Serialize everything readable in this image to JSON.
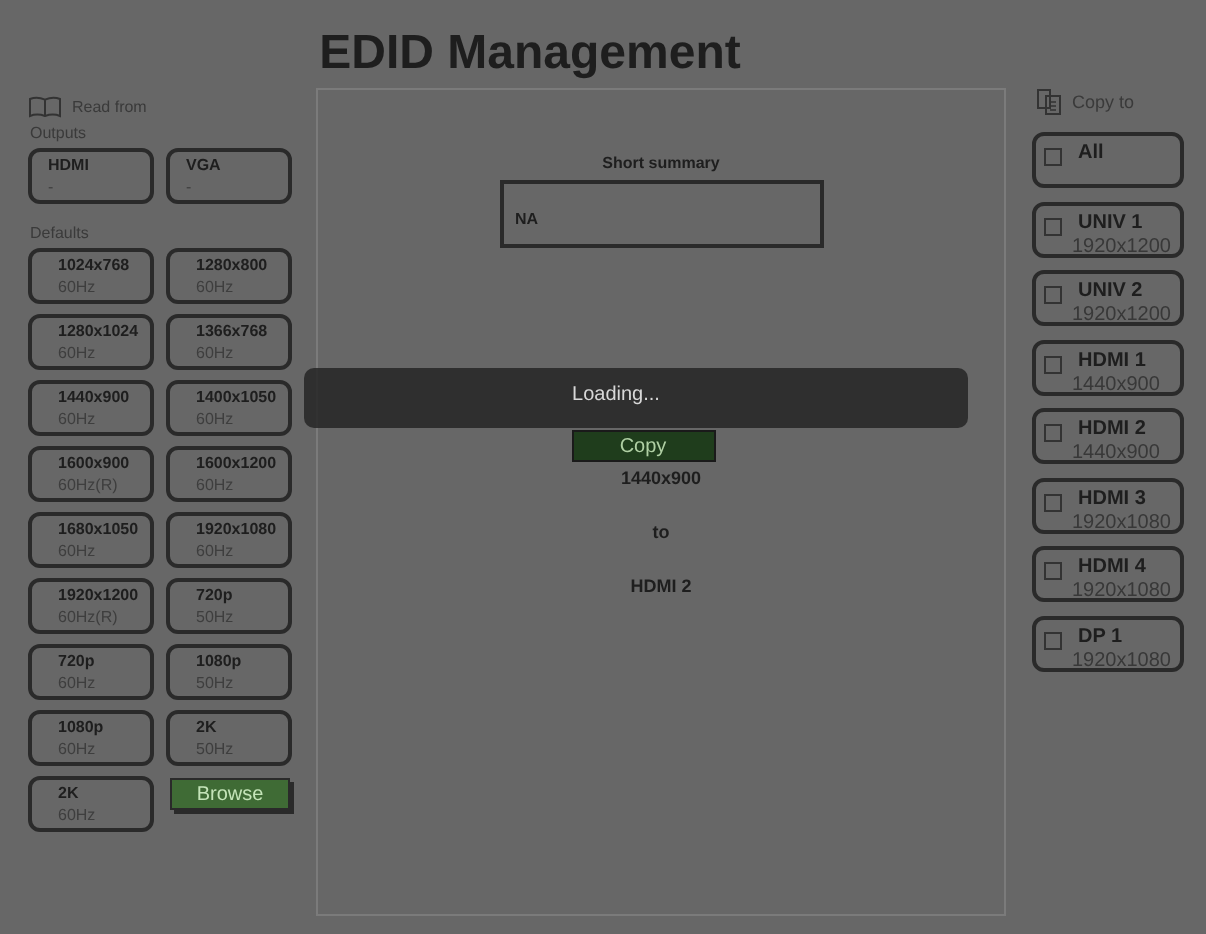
{
  "title": "EDID Management",
  "read_from": {
    "label": "Read from",
    "outputs_label": "Outputs",
    "outputs": [
      {
        "name": "HDMI",
        "detail": "-"
      },
      {
        "name": "VGA",
        "detail": "-"
      }
    ],
    "defaults_label": "Defaults",
    "defaults": [
      {
        "resolution": "1024x768",
        "rate": "60Hz"
      },
      {
        "resolution": "1280x800",
        "rate": "60Hz"
      },
      {
        "resolution": "1280x1024",
        "rate": "60Hz"
      },
      {
        "resolution": "1366x768",
        "rate": "60Hz"
      },
      {
        "resolution": "1440x900",
        "rate": "60Hz"
      },
      {
        "resolution": "1400x1050",
        "rate": "60Hz"
      },
      {
        "resolution": "1600x900",
        "rate": "60Hz(R)"
      },
      {
        "resolution": "1600x1200",
        "rate": "60Hz"
      },
      {
        "resolution": "1680x1050",
        "rate": "60Hz"
      },
      {
        "resolution": "1920x1080",
        "rate": "60Hz"
      },
      {
        "resolution": "1920x1200",
        "rate": "60Hz(R)"
      },
      {
        "resolution": "720p",
        "rate": "50Hz"
      },
      {
        "resolution": "720p",
        "rate": "60Hz"
      },
      {
        "resolution": "1080p",
        "rate": "50Hz"
      },
      {
        "resolution": "1080p",
        "rate": "60Hz"
      },
      {
        "resolution": "2K",
        "rate": "50Hz"
      },
      {
        "resolution": "2K",
        "rate": "60Hz"
      }
    ],
    "browse_button": "Browse"
  },
  "summary": {
    "label": "Short summary",
    "value": "NA"
  },
  "copy_button": "Copy",
  "loading": "Loading...",
  "copy_info": [
    "1440x900",
    "to",
    "HDMI 2"
  ],
  "copy_to": {
    "label": "Copy to",
    "targets": [
      {
        "name": "All",
        "checked": false
      },
      {
        "name": "UNIV 1",
        "detail": "1920x1200",
        "checked": false
      },
      {
        "name": "UNIV 2",
        "detail": "1920x1200",
        "checked": false
      },
      {
        "name": "HDMI 1",
        "detail": "1440x900",
        "checked": false
      },
      {
        "name": "HDMI 2",
        "detail": "1440x900",
        "checked": false
      },
      {
        "name": "HDMI 3",
        "detail": "1920x1080",
        "checked": false
      },
      {
        "name": "HDMI 4",
        "detail": "1920x1080",
        "checked": false
      },
      {
        "name": "DP 1",
        "detail": "1920x1080",
        "checked": false
      }
    ]
  }
}
